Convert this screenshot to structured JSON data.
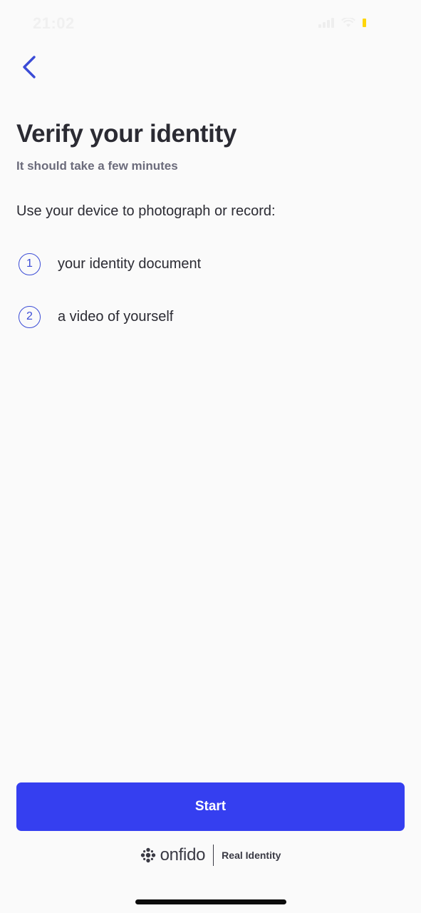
{
  "status_bar": {
    "time": "21:02",
    "battery_color": "#ffd60a"
  },
  "header": {
    "back_icon": "chevron-left-icon"
  },
  "main": {
    "title": "Verify your identity",
    "subtitle": "It should take a few minutes",
    "instruction": "Use your device to photograph or record:",
    "steps": [
      {
        "number": "1",
        "label": "your identity document"
      },
      {
        "number": "2",
        "label": "a video of yourself"
      }
    ]
  },
  "actions": {
    "start_label": "Start"
  },
  "footer": {
    "brand": "onfido",
    "tagline": "Real Identity"
  },
  "colors": {
    "accent": "#353ff0",
    "step_outline": "#3a4bd6",
    "text_primary": "#2b2b33",
    "text_secondary": "#6b6b7b",
    "background": "#fafafa"
  }
}
